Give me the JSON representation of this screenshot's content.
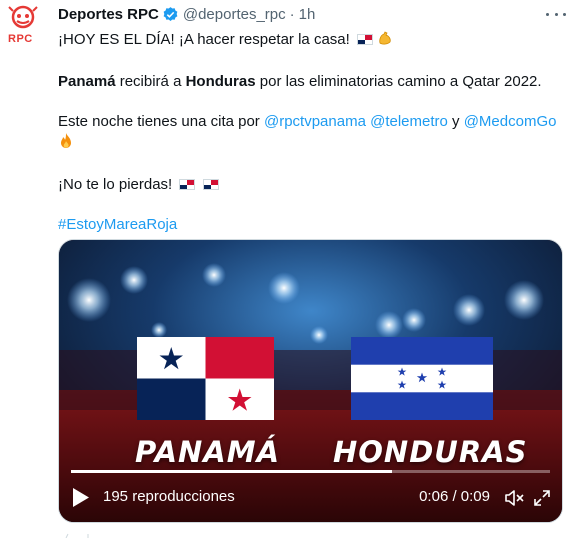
{
  "tweet": {
    "author": {
      "name": "Deportes RPC",
      "handle": "@deportes_rpc",
      "separator": "·",
      "time": "1h",
      "avatar_text": "RPC",
      "avatar_color": "#e53935",
      "verified": true
    },
    "lines": {
      "line1": "¡HOY ES EL DÍA! ¡A hacer respetar la casa!",
      "line2_team1": "Panamá",
      "line2_mid": " recibirá a ",
      "line2_team2": "Honduras",
      "line2_end": " por las eliminatorias camino a Qatar 2022.",
      "line3_start": "Este noche tienes una cita por ",
      "mention1": "@rpctvpanama",
      "space": " ",
      "mention2": "@telemetro",
      "line3_and": " y ",
      "mention3": "@MedcomGo",
      "line4": "¡No te lo pierdas!",
      "hashtag": "#EstoyMareaRoja"
    },
    "emoji": {
      "flexed_biceps": "flexed-biceps-icon",
      "fire": "fire-icon",
      "panama_flag": "panama-flag-icon"
    },
    "colors": {
      "link": "#1d9bf0",
      "secondary": "#536471",
      "text": "#0f1419",
      "verified": "#1d9bf0"
    }
  },
  "video": {
    "team_left": "PANAMÁ",
    "team_right": "HONDURAS",
    "views": "195 reproducciones",
    "time": "0:06 / 0:09",
    "progress": 0.67
  }
}
